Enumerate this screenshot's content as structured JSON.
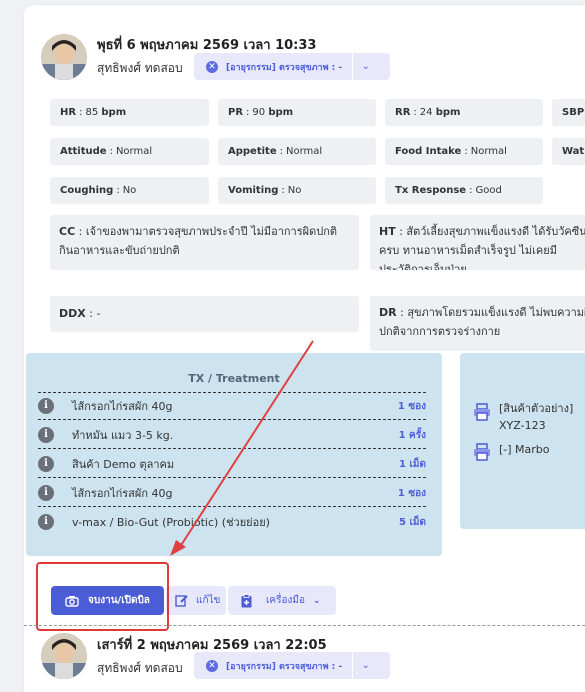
{
  "entry1": {
    "datetime": "พุธที่ 6 พฤษภาคม 2569 เวลา 10:33",
    "user": "สุทธิพงศ์ ทดสอบ",
    "status": "[อายุรกรรม] ตรวจสุขภาพ : -",
    "vitals_row1": [
      {
        "label": "HR",
        "value": "85",
        "unit": "bpm"
      },
      {
        "label": "PR",
        "value": "90",
        "unit": "bpm"
      },
      {
        "label": "RR",
        "value": "24",
        "unit": "bpm"
      },
      {
        "label": "SBP",
        "value": "",
        "unit": ""
      }
    ],
    "vitals_row2": [
      {
        "label": "Attitude",
        "value": "Normal"
      },
      {
        "label": "Appetite",
        "value": "Normal"
      },
      {
        "label": "Food Intake",
        "value": "Normal"
      },
      {
        "label": "Wat",
        "value": ""
      }
    ],
    "vitals_row3": [
      {
        "label": "Coughing",
        "value": "No"
      },
      {
        "label": "Vomiting",
        "value": "No"
      },
      {
        "label": "Tx Response",
        "value": "Good"
      }
    ],
    "cc_label": "CC",
    "cc_text": "เจ้าของพามาตรวจสุขภาพประจำปี ไม่มีอาการผิดปกติ กินอาหารและขับถ่ายปกติ",
    "ht_label": "HT",
    "ht_text": "สัตว์เลี้ยงสุขภาพแข็งแรงดี ได้รับวัคซีนครบ ทานอาหารเม็ดสำเร็จรูป ไม่เคยมีประวัติการเจ็บป่วย",
    "ddx_label": "DDX",
    "ddx_text": "-",
    "dr_label": "DR",
    "dr_text": "สุขภาพโดยรวมแข็งแรงดี ไม่พบความผิดปกติจากการตรวจร่างกาย",
    "tx_title": "TX / Treatment",
    "treatments": [
      {
        "name": "ไส้กรอกไก่รสผัก 40g",
        "qty": "1 ซอง"
      },
      {
        "name": "ทำหมัน แมว 3-5 kg.",
        "qty": "1 ครั้ง"
      },
      {
        "name": "สินค้า Demo ตุลาคม",
        "qty": "1 เม็ด"
      },
      {
        "name": "ไส้กรอกไก่รสผัก 40g",
        "qty": "1 ซอง"
      },
      {
        "name": "v-max / Bio-Gut (Probiotic) (ช่วยย่อย)",
        "qty": "5 เม็ด"
      }
    ],
    "prints": [
      {
        "line1": "[สินค้าตัวอย่าง]",
        "line2": "XYZ-123"
      },
      {
        "line1": "[-] Marbo",
        "line2": ""
      }
    ],
    "buttons": {
      "checkout": "จบงาน/เปิดบิล",
      "edit": "แก้ไข",
      "tools": "เครื่องมือ"
    }
  },
  "entry2": {
    "datetime": "เสาร์ที่ 2 พฤษภาคม 2569 เวลา 22:05",
    "user": "สุทธิพงศ์ ทดสอบ",
    "status": "[อายุรกรรม] ตรวจสุขภาพ : -"
  },
  "colors": {
    "accent": "#4b5cd7",
    "highlight": "#e03838",
    "tx_panel": "#cde3ef"
  }
}
